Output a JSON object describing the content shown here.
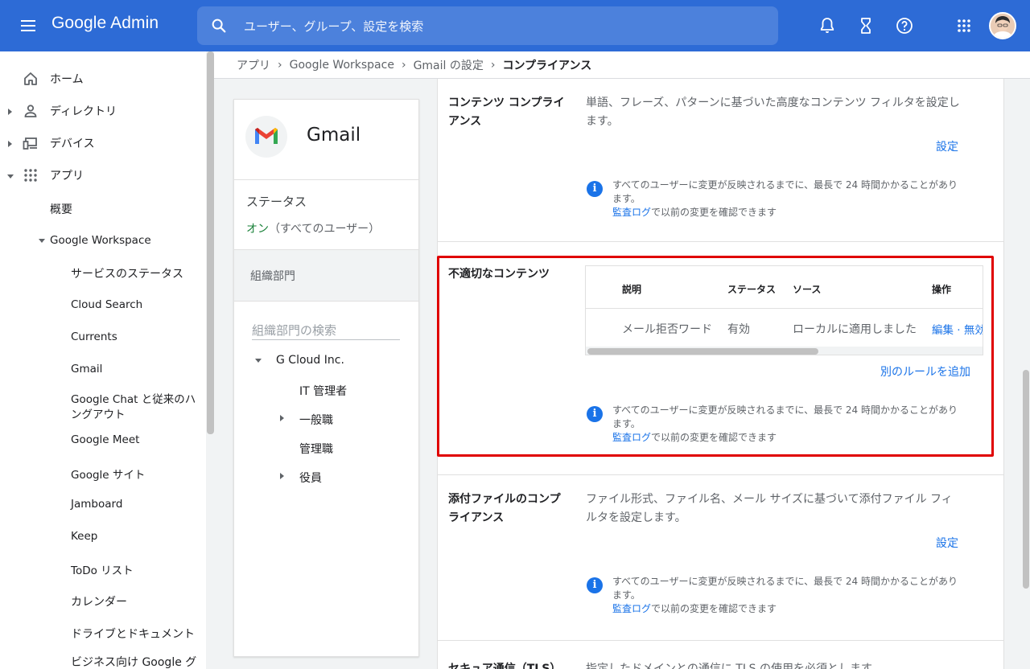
{
  "header": {
    "brand": "Google Admin",
    "search_placeholder": "ユーザー、グループ、設定を検索"
  },
  "icons": {
    "menu": "menu-icon",
    "search": "search-icon",
    "notifications": "bell-icon",
    "tasks": "hourglass-icon",
    "help": "help-icon",
    "apps": "apps-grid-icon"
  },
  "nav": {
    "items": [
      {
        "label": "ホーム"
      },
      {
        "label": "ディレクトリ"
      },
      {
        "label": "デバイス"
      },
      {
        "label": "アプリ"
      },
      {
        "label": "概要"
      },
      {
        "label": "Google Workspace"
      },
      {
        "label": "サービスのステータス"
      },
      {
        "label": "Cloud Search"
      },
      {
        "label": "Currents"
      },
      {
        "label": "Gmail"
      },
      {
        "label": "Google Chat と従来のハ"
      },
      {
        "label": "ングアウト"
      },
      {
        "label": "Google Meet"
      },
      {
        "label": "Google サイト"
      },
      {
        "label": "Jamboard"
      },
      {
        "label": "Keep"
      },
      {
        "label": "ToDo リスト"
      },
      {
        "label": "カレンダー"
      },
      {
        "label": "ドライブとドキュメント"
      },
      {
        "label": "ビジネス向け Google グ"
      }
    ]
  },
  "breadcrumb": {
    "items": [
      "アプリ",
      "Google Workspace",
      "Gmail の設定",
      "コンプライアンス"
    ]
  },
  "app_card": {
    "title": "Gmail",
    "status_label": "ステータス",
    "status_on": "オン",
    "status_scope": "（すべてのユーザー）",
    "org_unit_label": "組織部門",
    "org_search_placeholder": "組織部門の検索",
    "org_tree": [
      {
        "label": "G Cloud Inc."
      },
      {
        "label": "IT 管理者"
      },
      {
        "label": "一般職"
      },
      {
        "label": "管理職"
      },
      {
        "label": "役員"
      }
    ]
  },
  "sections": {
    "content_compliance": {
      "title_line1": "コンテンツ コンプライ",
      "title_line2": "アンス",
      "desc_line1": "単語、フレーズ、パターンに基づいた高度なコンテンツ フィルタを設定し",
      "desc_line2": "ます。",
      "action": "設定"
    },
    "objectionable": {
      "title": "不適切なコンテンツ",
      "table_headers": [
        "説明",
        "ステータス",
        "ソース",
        "操作"
      ],
      "row": {
        "description": "メール拒否ワード",
        "status": "有効",
        "source": "ローカルに適用しました",
        "actions": "編集 · 無効"
      },
      "add_rule": "別のルールを追加"
    },
    "attachment_compliance": {
      "title_line1": "添付ファイルのコンプ",
      "title_line2": "ライアンス",
      "desc_line1": "ファイル形式、ファイル名、メール サイズに基づいて添付ファイル フィ",
      "desc_line2": "ルタを設定します。",
      "action": "設定"
    },
    "secure_transport": {
      "title": "セキュア通信（TLS）",
      "desc": "指定したドメインとの通信に TLS の使用を必須とします。"
    }
  },
  "info_notice": {
    "line1": "すべてのユーザーに変更が反映されるまでに、最長で 24 時間かかることがあり",
    "line2": "ます。",
    "audit_link": "監査ログ",
    "audit_suffix": "で以前の変更を確認できます"
  },
  "colors": {
    "header_bg": "#2d6bd6",
    "link": "#1a73e8",
    "status_on": "#188038",
    "highlight": "#e00000"
  }
}
